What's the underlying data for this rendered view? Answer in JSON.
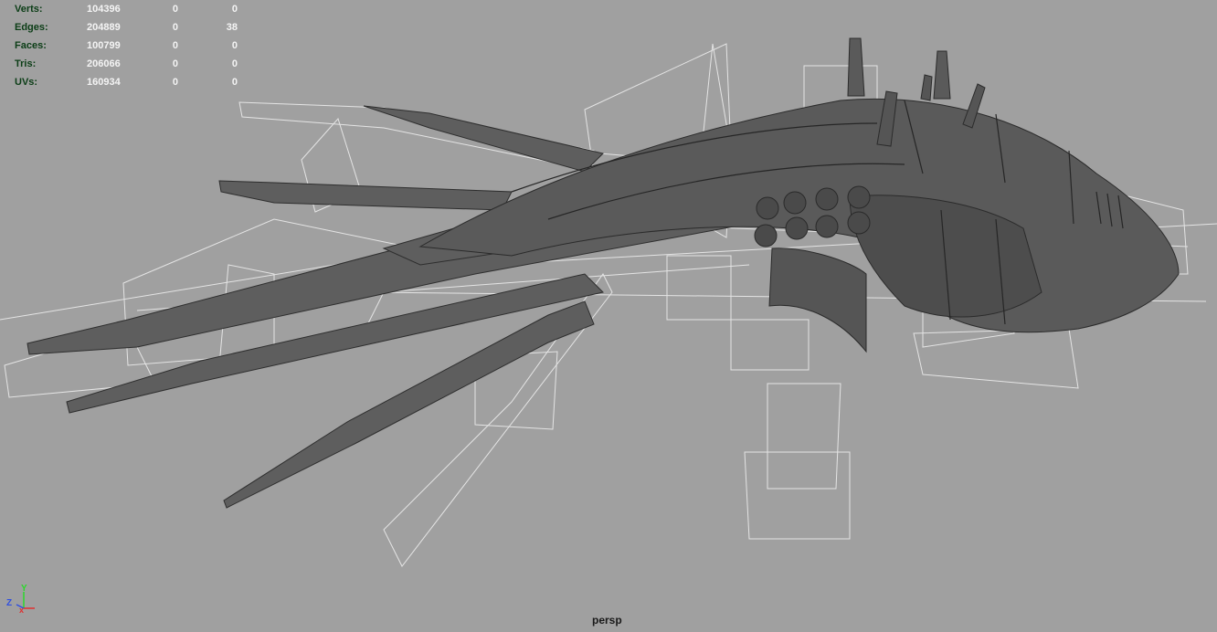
{
  "hud": {
    "rows": [
      {
        "label": "Verts:",
        "v1": "104396",
        "v2": "0",
        "v3": "0"
      },
      {
        "label": "Edges:",
        "v1": "204889",
        "v2": "0",
        "v3": "38"
      },
      {
        "label": "Faces:",
        "v1": "100799",
        "v2": "0",
        "v3": "0"
      },
      {
        "label": "Tris:",
        "v1": "206066",
        "v2": "0",
        "v3": "0"
      },
      {
        "label": "UVs:",
        "v1": "160934",
        "v2": "0",
        "v3": "0"
      }
    ]
  },
  "viewport": {
    "camera": "persp",
    "axis": {
      "y": "Y",
      "z": "Z",
      "x": "x"
    }
  },
  "colors": {
    "background": "#a0a0a0",
    "hud_label": "#0b3d16",
    "hud_value": "#f4f4f4",
    "mesh": "#5c5c5c",
    "wireframe": "#e6e6e6"
  }
}
